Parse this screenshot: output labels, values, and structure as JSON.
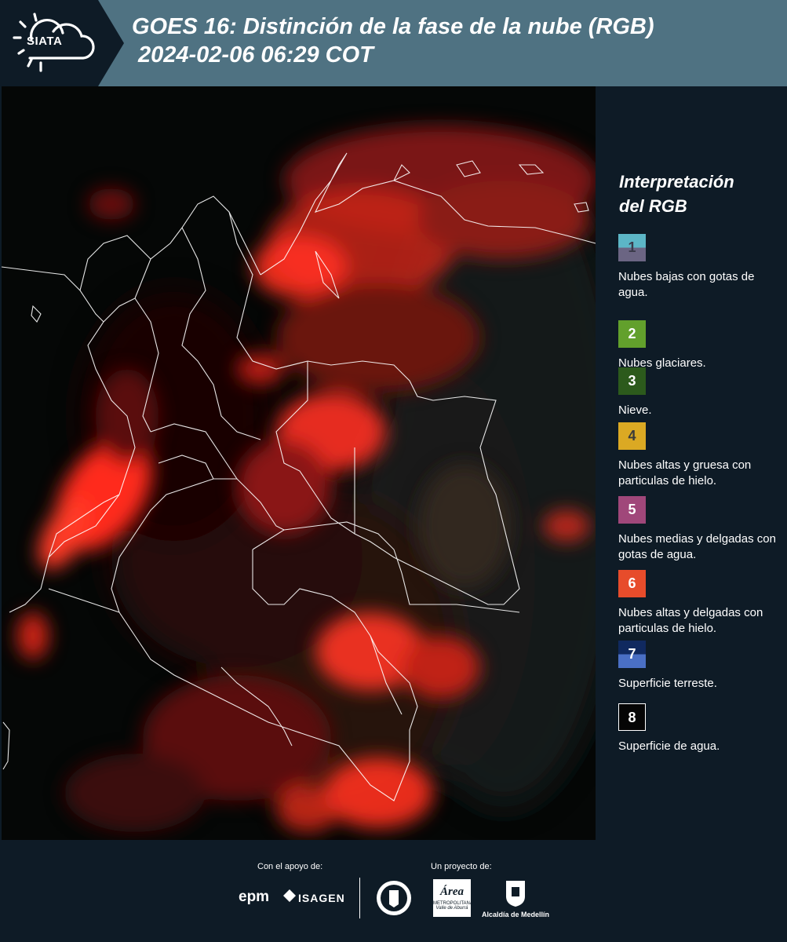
{
  "header": {
    "logo_text": "SIATA",
    "title_line1": "GOES 16: Distinción de la fase de la nube (RGB)",
    "title_line2": "2024-02-06 06:29 COT"
  },
  "legend": {
    "title_line1": "Interpretación",
    "title_line2": "del RGB",
    "items": [
      {
        "num": "1",
        "label": "Nubes bajas con gotas de agua.",
        "color_top": "#5cb6c6",
        "color_bottom": "#6b6583",
        "text_color": "#3a3a4a"
      },
      {
        "num": "2",
        "label": "Nubes glaciares.",
        "color_top": "#62a02c",
        "color_bottom": "#62a02c",
        "text_color": "#ffffff"
      },
      {
        "num": "3",
        "label": "Nieve.",
        "color_top": "#2c5a1c",
        "color_bottom": "#2c5a1c",
        "text_color": "#ffffff"
      },
      {
        "num": "4",
        "label": "Nubes altas y gruesa con particulas de hielo.",
        "color_top": "#dba923",
        "color_bottom": "#dba923",
        "text_color": "#3a3a3a"
      },
      {
        "num": "5",
        "label": "Nubes medias y delgadas con gotas de agua.",
        "color_top": "#a0477a",
        "color_bottom": "#a0477a",
        "text_color": "#ffffff"
      },
      {
        "num": "6",
        "label": "Nubes altas y delgadas con particulas de hielo.",
        "color_top": "#e74c2b",
        "color_bottom": "#e74c2b",
        "text_color": "#ffffff"
      },
      {
        "num": "7",
        "label": "Superficie terreste.",
        "color_top": "#10295f",
        "color_bottom": "#4a6fc4",
        "text_color": "#ffffff"
      },
      {
        "num": "8",
        "label": "Superficie de agua.",
        "color_top": "#050505",
        "color_bottom": "#050505",
        "text_color": "#ffffff"
      }
    ]
  },
  "footer": {
    "support_label": "Con el apoyo de:",
    "project_label": "Un proyecto de:",
    "epm": "epm",
    "isagen": "ISAGEN",
    "area_logo": "Área",
    "area_line1": "METROPOLITANA",
    "area_line2": "Valle de Aburrá",
    "alcaldia": "Alcaldía de Medellín"
  },
  "colors": {
    "header_bg": "#4f7282",
    "page_bg": "#0e1b26",
    "cloud_red": "#ff2a1a"
  }
}
